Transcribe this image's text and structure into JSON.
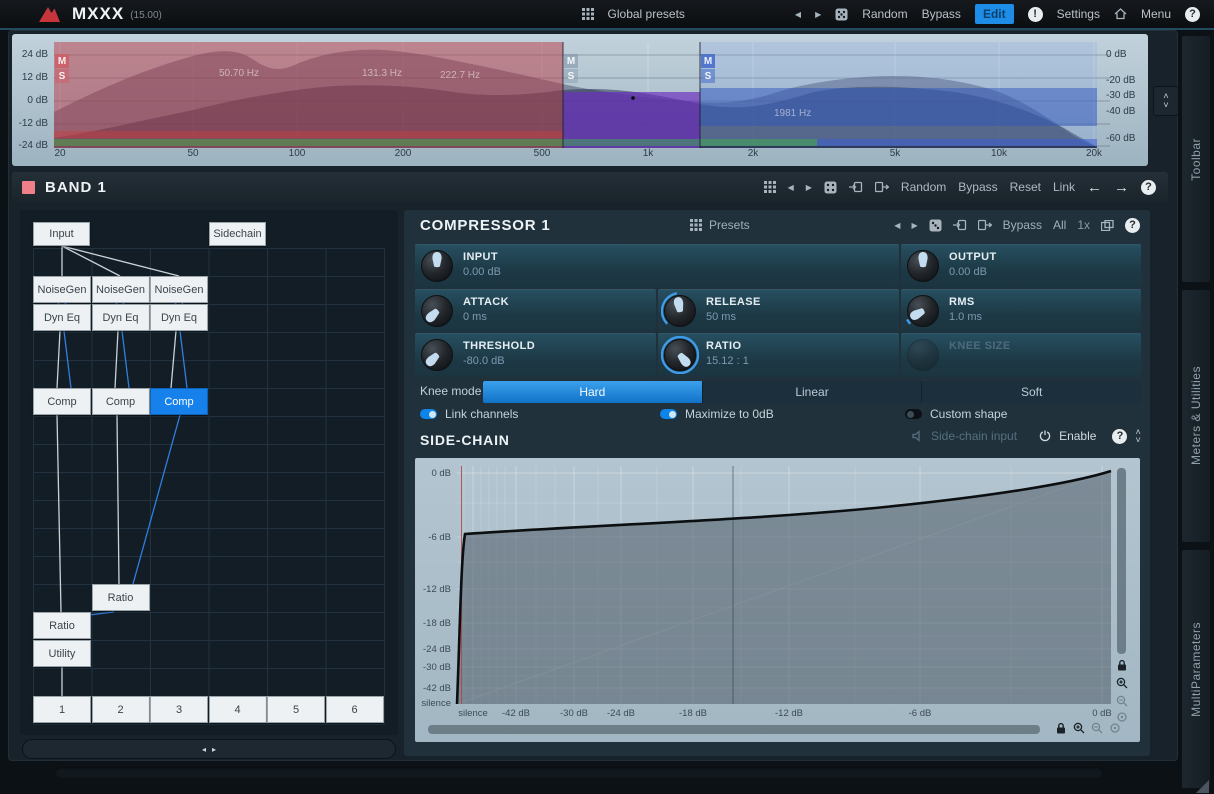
{
  "topbar": {
    "logo": "MXXX",
    "version": "(15.00)",
    "global_presets": "Global presets",
    "random": "Random",
    "bypass": "Bypass",
    "edit": "Edit",
    "settings": "Settings",
    "menu": "Menu"
  },
  "icons": {
    "prev": "◀",
    "next": "▶",
    "back": "←",
    "forward": "→",
    "help": "?",
    "alert": "!",
    "up": "˄",
    "down": "˅",
    "left_small": "◂",
    "right_small": "▸"
  },
  "eq": {
    "left_ticks": [
      "24 dB",
      "12 dB",
      "0 dB",
      "-12 dB",
      "-24 dB"
    ],
    "right_ticks": [
      "0 dB",
      "-20 dB",
      "-30 dB",
      "-40 dB",
      "-60 dB"
    ],
    "freq_ticks": [
      "20",
      "50",
      "100",
      "200",
      "500",
      "1k",
      "2k",
      "5k",
      "10k",
      "20k"
    ],
    "crossover_labels": [
      "50.70 Hz",
      "131.3 Hz",
      "222.7 Hz",
      "1981 Hz"
    ],
    "band_markers": {
      "m": "M",
      "s": "S"
    }
  },
  "band_header": {
    "title": "BAND 1",
    "random": "Random",
    "bypass": "Bypass",
    "reset": "Reset",
    "link": "Link"
  },
  "node_graph": {
    "input": "Input",
    "sidechain": "Sidechain",
    "noisegen": "NoiseGen",
    "dyneq": "Dyn Eq",
    "comp": "Comp",
    "ratio": "Ratio",
    "utility": "Utility",
    "outputs": [
      "1",
      "2",
      "3",
      "4",
      "5",
      "6"
    ]
  },
  "compressor": {
    "title": "COMPRESSOR 1",
    "presets": "Presets",
    "bypass": "Bypass",
    "all": "All",
    "multiplier": "1x",
    "knobs": [
      {
        "label": "INPUT",
        "value": "0.00 dB"
      },
      {
        "label": "OUTPUT",
        "value": "0.00 dB"
      },
      {
        "label": "ATTACK",
        "value": "0 ms"
      },
      {
        "label": "RELEASE",
        "value": "50 ms"
      },
      {
        "label": "RMS",
        "value": "1.0 ms"
      },
      {
        "label": "THRESHOLD",
        "value": "-80.0 dB"
      },
      {
        "label": "RATIO",
        "value": "15.12 : 1"
      },
      {
        "label": "KNEE SIZE",
        "value": ""
      }
    ],
    "knee_mode": {
      "label": "Knee mode",
      "options": [
        "Hard",
        "Linear",
        "Soft"
      ],
      "selected": "Hard"
    },
    "toggles": [
      {
        "label": "Link channels",
        "on": true
      },
      {
        "label": "Maximize to 0dB",
        "on": true
      },
      {
        "label": "Custom shape",
        "on": false
      }
    ]
  },
  "sidechain": {
    "title": "SIDE-CHAIN",
    "input_label": "Side-chain input",
    "enable": "Enable",
    "graph": {
      "y_ticks": [
        "0 dB",
        "-6 dB",
        "-12 dB",
        "-18 dB",
        "-24 dB",
        "-30 dB",
        "-42 dB",
        "silence"
      ],
      "x_ticks": [
        "silence",
        "-42 dB",
        "-30 dB",
        "-24 dB",
        "-18 dB",
        "-12 dB",
        "-6 dB",
        "0 dB"
      ],
      "curve": {
        "points_db": [
          [
            "silence",
            "silence"
          ],
          [
            "silence+",
            -5.2
          ],
          [
            "-24",
            -4.2
          ],
          [
            "-12",
            -3.0
          ],
          [
            "0",
            0.0
          ]
        ]
      }
    }
  },
  "sidebar": {
    "tabs": [
      "Toolbar",
      "Meters & Utilities",
      "MultiParameters"
    ]
  }
}
